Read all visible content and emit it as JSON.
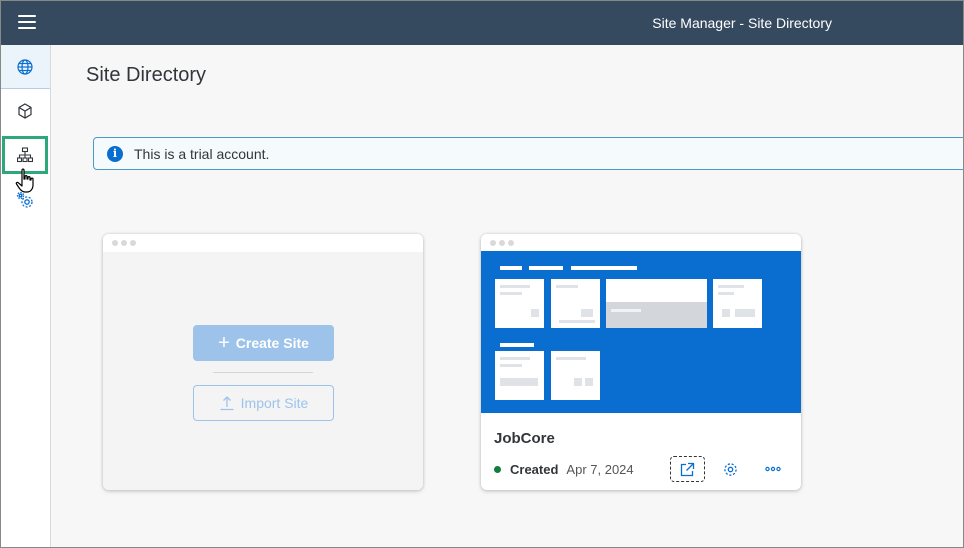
{
  "header": {
    "title": "Site Manager - Site Directory"
  },
  "sidebar": {
    "items": [
      {
        "icon": "globe-icon",
        "active": true
      },
      {
        "icon": "cube-icon",
        "active": false
      },
      {
        "icon": "sitemap-icon",
        "active": false
      },
      {
        "icon": "gears-icon",
        "active": false
      }
    ]
  },
  "page": {
    "title": "Site Directory"
  },
  "info": {
    "text": "This is a trial account."
  },
  "create_card": {
    "create_label": "Create Site",
    "import_label": "Import Site"
  },
  "site_card": {
    "name": "JobCore",
    "status": "Created",
    "date": "Apr 7, 2024",
    "status_color": "#107e3e",
    "preview_color": "#0a6ed1"
  },
  "colors": {
    "shell": "#354a5f",
    "accent": "#0a6ed1",
    "highlight_box": "#2da87a"
  }
}
